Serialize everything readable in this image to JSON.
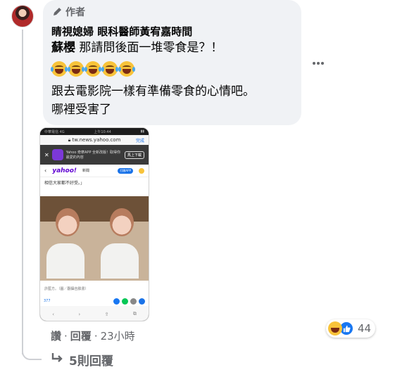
{
  "comment": {
    "author_badge": "作者",
    "commenter_name": "睛視媳婦 眼科醫師黃宥嘉時間",
    "mention": "蘇櫻",
    "line1": "那請問後面一堆零食是？！",
    "emoji_count": 5,
    "line2": "跟去電影院一樣有準備零食的心情吧。",
    "line3": "哪裡受害了"
  },
  "attachment": {
    "status_left": "中華電信 4G",
    "status_time": "上午10:44",
    "url": "tw.news.yahoo.com",
    "done_label": "完成",
    "app_text": "Yahoo 奇摩APP 全新改版！取得你最愛的內容",
    "open_label": "馬上下載",
    "logo": "yahoo!",
    "news_label": "新聞",
    "pill_label": "打開APP",
    "quote": "相信大家都不好受。」",
    "credit": "許藍方。（圖／翻攝自臉書）",
    "count": "377"
  },
  "actions": {
    "like": "讚",
    "reply": "回覆",
    "time": "23小時"
  },
  "reactions": {
    "count": "44"
  },
  "replies": {
    "label": "5則回覆"
  }
}
